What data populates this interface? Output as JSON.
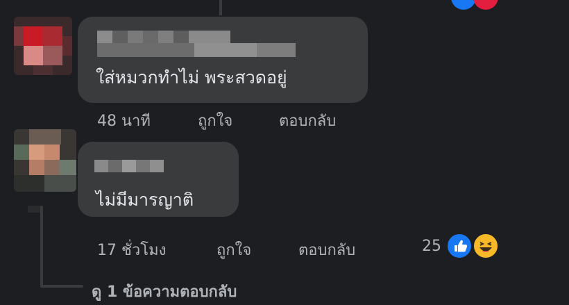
{
  "comments": [
    {
      "text": "ใส่หมวกทำไม่ พระสวดอยู่",
      "time": "48 นาที",
      "like_label": "ถูกใจ",
      "reply_label": "ตอบกลับ"
    },
    {
      "text": "ไม่มีมารญาติ",
      "time": "17 ชั่วโมง",
      "like_label": "ถูกใจ",
      "reply_label": "ตอบกลับ",
      "reaction_count": "25",
      "reactions": [
        "like-icon",
        "haha-icon"
      ]
    }
  ],
  "view_replies": "ดู 1 ข้อความตอบกลับ",
  "colors": {
    "background": "#1c1e21",
    "bubble": "#3a3b3c",
    "text": "#e4e6eb",
    "meta": "#b0b3b8",
    "like": "#1877f2",
    "haha": "#f7b928"
  }
}
